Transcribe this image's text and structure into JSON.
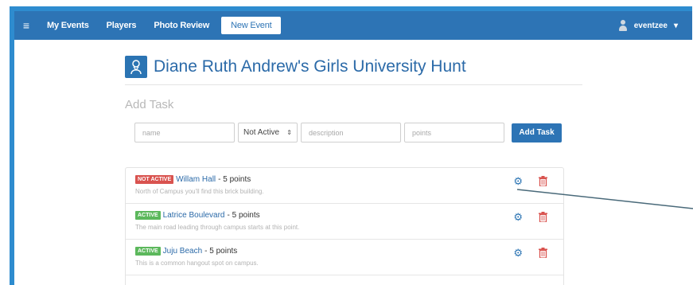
{
  "navbar": {
    "menu_icon": "hamburger-icon",
    "links": [
      "My Events",
      "Players",
      "Photo Review"
    ],
    "active_link": "New Event",
    "user_name": "eventzee",
    "user_caret": "▾"
  },
  "header": {
    "title": "Diane Ruth Andrew's Girls University Hunt"
  },
  "add_task": {
    "section_title": "Add Task",
    "name_placeholder": "name",
    "status_value": "Not Active",
    "description_placeholder": "description",
    "points_placeholder": "points",
    "button_label": "Add Task"
  },
  "tasks": [
    {
      "badge": "NOT ACTIVE",
      "badge_color": "#d9534f",
      "name": "Willam Hall",
      "points_text": "- 5 points",
      "description": "North of Campus you'll find this brick building."
    },
    {
      "badge": "ACTIVE",
      "badge_color": "#5cb85c",
      "name": "Latrice Boulevard",
      "points_text": "- 5 points",
      "description": "The main road leading through campus starts at this point."
    },
    {
      "badge": "ACTIVE",
      "badge_color": "#5cb85c",
      "name": "Juju Beach",
      "points_text": "- 5 points",
      "description": "This is a common hangout spot on campus."
    }
  ],
  "colors": {
    "brand": "#2d74b5",
    "frame": "#2e8ccf",
    "danger": "#d9534f",
    "success": "#5cb85c"
  }
}
